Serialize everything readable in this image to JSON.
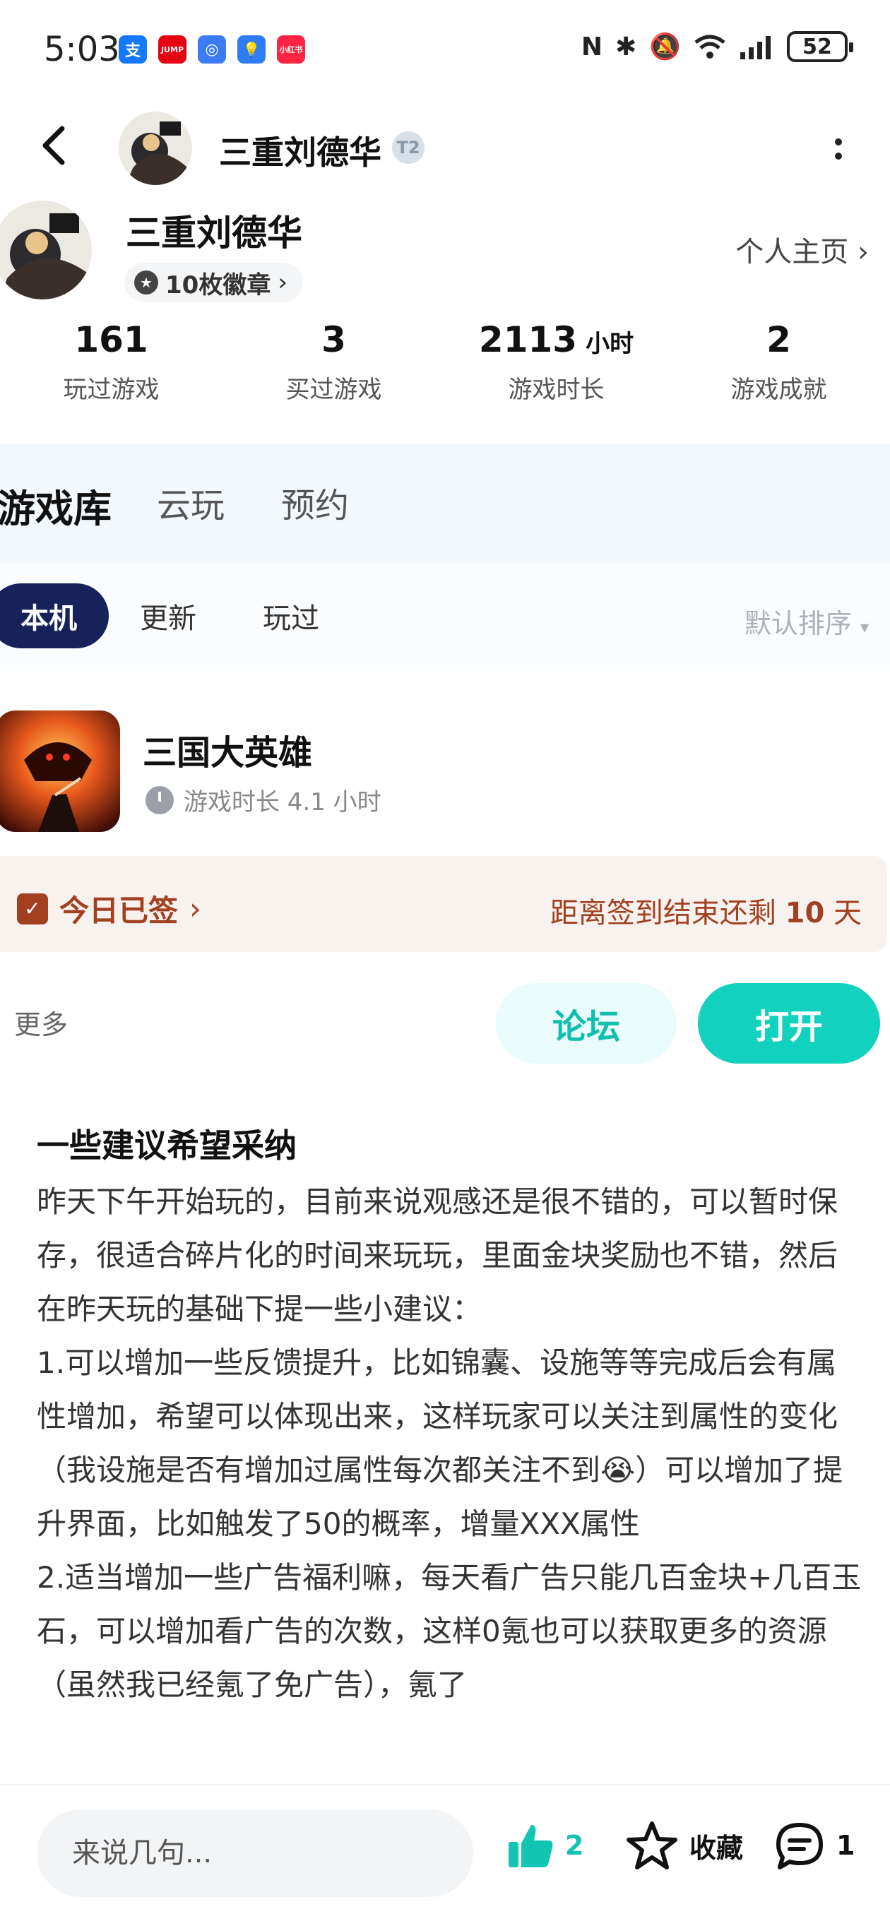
{
  "status_bar": {
    "time": "5:03",
    "notifications": [
      {
        "name": "alipay-icon",
        "glyph": "支",
        "color": "#1677ff"
      },
      {
        "name": "jump-icon",
        "glyph": "JUMP",
        "color": "#e60012"
      },
      {
        "name": "app-icon",
        "glyph": "◎",
        "color": "#3b7cf5"
      },
      {
        "name": "bulb-icon",
        "glyph": "💡",
        "color": "#2f7df6"
      },
      {
        "name": "xiaohongshu-icon",
        "glyph": "小红书",
        "color": "#ff2442"
      }
    ],
    "battery": "52"
  },
  "header": {
    "title": "三重刘德华",
    "tier": "T2"
  },
  "profile": {
    "name": "三重刘德华",
    "badges": "10枚徽章",
    "homepage_link": "个人主页"
  },
  "stats": [
    {
      "value": "161",
      "unit": "",
      "label": "玩过游戏"
    },
    {
      "value": "3",
      "unit": "",
      "label": "买过游戏"
    },
    {
      "value": "2113",
      "unit": "小时",
      "label": "游戏时长"
    },
    {
      "value": "2",
      "unit": "",
      "label": "游戏成就"
    }
  ],
  "library_tabs": [
    "游戏库",
    "云玩",
    "预约"
  ],
  "filters": {
    "chips": [
      "本机",
      "更新",
      "玩过"
    ],
    "sort": "默认排序"
  },
  "game": {
    "title": "三国大英雄",
    "playtime": "游戏时长 4.1 小时"
  },
  "signin": {
    "status": "今日已签",
    "remaining_prefix": "距离签到结束还剩",
    "remaining_days": "10",
    "remaining_suffix": "天"
  },
  "actions": {
    "more": "更多",
    "forum": "论坛",
    "open": "打开"
  },
  "review": {
    "title": "一些建议希望采纳",
    "body": "昨天下午开始玩的，目前来说观感还是很不错的，可以暂时保存，很适合碎片化的时间来玩玩，里面金块奖励也不错，然后在昨天玩的基础下提一些小建议：\n1.可以增加一些反馈提升，比如锦囊、设施等等完成后会有属性增加，希望可以体现出来，这样玩家可以关注到属性的变化（我设施是否有增加过属性每次都关注不到😭）可以增加了提升界面，比如触发了50的概率，增量XXX属性\n2.适当增加一些广告福利嘛，每天看广告只能几百金块+几百玉石，可以增加看广告的次数，这样0氪也可以获取更多的资源（虽然我已经氪了免广告），氪了"
  },
  "bottom_bar": {
    "comment_placeholder": "来说几句...",
    "likes": "2",
    "favorite": "收藏",
    "comments": "1"
  }
}
